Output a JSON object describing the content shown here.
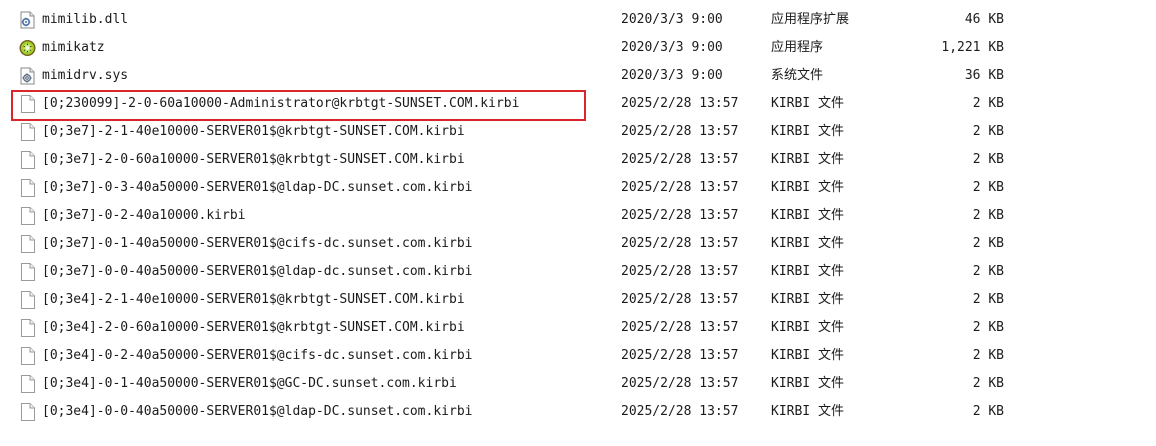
{
  "highlight_color": "#d8262b",
  "files": [
    {
      "name": "mimilib.dll",
      "date": "2020/3/3 9:00",
      "type": "应用程序扩展",
      "size": "46 KB",
      "icon": "dll-file-icon"
    },
    {
      "name": "mimikatz",
      "date": "2020/3/3 9:00",
      "type": "应用程序",
      "size": "1,221 KB",
      "icon": "kiwi-app-icon"
    },
    {
      "name": "mimidrv.sys",
      "date": "2020/3/3 9:00",
      "type": "系统文件",
      "size": "36 KB",
      "icon": "system-file-icon"
    },
    {
      "name": "[0;230099]-2-0-60a10000-Administrator@krbtgt-SUNSET.COM.kirbi",
      "date": "2025/2/28 13:57",
      "type": "KIRBI 文件",
      "size": "2 KB",
      "icon": "blank-file-icon",
      "highlighted": true
    },
    {
      "name": "[0;3e7]-2-1-40e10000-SERVER01$@krbtgt-SUNSET.COM.kirbi",
      "date": "2025/2/28 13:57",
      "type": "KIRBI 文件",
      "size": "2 KB",
      "icon": "blank-file-icon"
    },
    {
      "name": "[0;3e7]-2-0-60a10000-SERVER01$@krbtgt-SUNSET.COM.kirbi",
      "date": "2025/2/28 13:57",
      "type": "KIRBI 文件",
      "size": "2 KB",
      "icon": "blank-file-icon"
    },
    {
      "name": "[0;3e7]-0-3-40a50000-SERVER01$@ldap-DC.sunset.com.kirbi",
      "date": "2025/2/28 13:57",
      "type": "KIRBI 文件",
      "size": "2 KB",
      "icon": "blank-file-icon"
    },
    {
      "name": "[0;3e7]-0-2-40a10000.kirbi",
      "date": "2025/2/28 13:57",
      "type": "KIRBI 文件",
      "size": "2 KB",
      "icon": "blank-file-icon"
    },
    {
      "name": "[0;3e7]-0-1-40a50000-SERVER01$@cifs-dc.sunset.com.kirbi",
      "date": "2025/2/28 13:57",
      "type": "KIRBI 文件",
      "size": "2 KB",
      "icon": "blank-file-icon"
    },
    {
      "name": "[0;3e7]-0-0-40a50000-SERVER01$@ldap-dc.sunset.com.kirbi",
      "date": "2025/2/28 13:57",
      "type": "KIRBI 文件",
      "size": "2 KB",
      "icon": "blank-file-icon"
    },
    {
      "name": "[0;3e4]-2-1-40e10000-SERVER01$@krbtgt-SUNSET.COM.kirbi",
      "date": "2025/2/28 13:57",
      "type": "KIRBI 文件",
      "size": "2 KB",
      "icon": "blank-file-icon"
    },
    {
      "name": "[0;3e4]-2-0-60a10000-SERVER01$@krbtgt-SUNSET.COM.kirbi",
      "date": "2025/2/28 13:57",
      "type": "KIRBI 文件",
      "size": "2 KB",
      "icon": "blank-file-icon"
    },
    {
      "name": "[0;3e4]-0-2-40a50000-SERVER01$@cifs-dc.sunset.com.kirbi",
      "date": "2025/2/28 13:57",
      "type": "KIRBI 文件",
      "size": "2 KB",
      "icon": "blank-file-icon"
    },
    {
      "name": "[0;3e4]-0-1-40a50000-SERVER01$@GC-DC.sunset.com.kirbi",
      "date": "2025/2/28 13:57",
      "type": "KIRBI 文件",
      "size": "2 KB",
      "icon": "blank-file-icon"
    },
    {
      "name": "[0;3e4]-0-0-40a50000-SERVER01$@ldap-DC.sunset.com.kirbi",
      "date": "2025/2/28 13:57",
      "type": "KIRBI 文件",
      "size": "2 KB",
      "icon": "blank-file-icon"
    }
  ]
}
